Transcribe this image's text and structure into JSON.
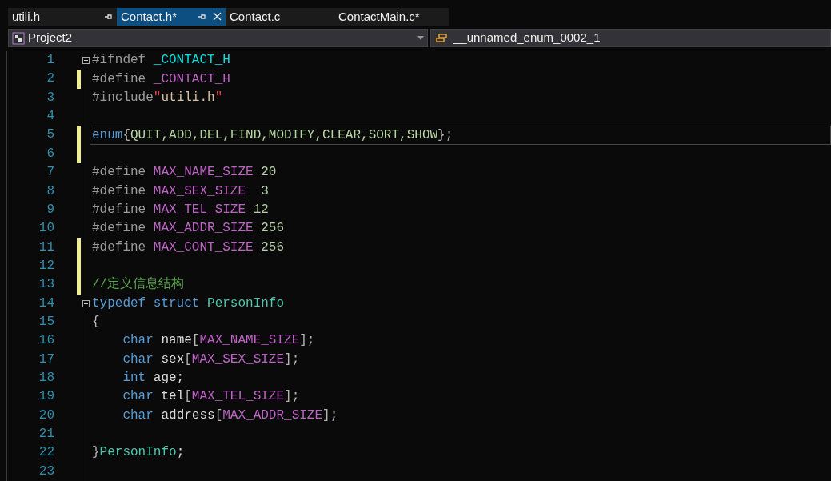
{
  "tabs": [
    {
      "label": "utili.h",
      "selected": false,
      "pinned": true,
      "closable": false
    },
    {
      "label": "Contact.h*",
      "selected": true,
      "pinned": true,
      "closable": true
    },
    {
      "label": "Contact.c",
      "selected": false,
      "pinned": false,
      "closable": false
    },
    {
      "label": "ContactMain.c*",
      "selected": false,
      "pinned": false,
      "closable": false
    }
  ],
  "navigation": {
    "project": "Project2",
    "member": "__unnamed_enum_0002_1"
  },
  "editor": {
    "lines": [
      {
        "number": "1",
        "changed": false,
        "current": false,
        "fold_expanded": true,
        "tokens": [
          {
            "kind": "preproc",
            "text": "#ifndef "
          },
          {
            "kind": "guard",
            "text": "_CONTACT_H"
          }
        ]
      },
      {
        "number": "2",
        "changed": true,
        "current": false,
        "tokens": [
          {
            "kind": "preproc",
            "text": "#define "
          },
          {
            "kind": "macro",
            "text": "_CONTACT_H"
          }
        ]
      },
      {
        "number": "3",
        "changed": false,
        "current": false,
        "tokens": [
          {
            "kind": "preproc",
            "text": "#include"
          },
          {
            "kind": "quote",
            "text": "\""
          },
          {
            "kind": "string",
            "text": "utili.h"
          },
          {
            "kind": "quote",
            "text": "\""
          }
        ]
      },
      {
        "number": "4",
        "changed": false,
        "current": false
      },
      {
        "number": "5",
        "changed": true,
        "current": true,
        "tokens": [
          {
            "kind": "keyword",
            "text": "enum"
          },
          {
            "kind": "punct",
            "text": "{"
          },
          {
            "kind": "enumerator",
            "text": "QUIT,ADD,DEL,FIND,MODIFY,CLEAR,SORT,SHOW"
          },
          {
            "kind": "punct",
            "text": "};"
          }
        ]
      },
      {
        "number": "6",
        "changed": true,
        "current": false
      },
      {
        "number": "7",
        "changed": false,
        "current": false,
        "tokens": [
          {
            "kind": "preproc",
            "text": "#define "
          },
          {
            "kind": "macro",
            "text": "MAX_NAME_SIZE"
          },
          {
            "kind": "number",
            "text": " 20"
          }
        ]
      },
      {
        "number": "8",
        "changed": false,
        "current": false,
        "tokens": [
          {
            "kind": "preproc",
            "text": "#define "
          },
          {
            "kind": "macro",
            "text": "MAX_SEX_SIZE"
          },
          {
            "kind": "number",
            "text": "  3"
          }
        ]
      },
      {
        "number": "9",
        "changed": false,
        "current": false,
        "tokens": [
          {
            "kind": "preproc",
            "text": "#define "
          },
          {
            "kind": "macro",
            "text": "MAX_TEL_SIZE"
          },
          {
            "kind": "number",
            "text": " 12"
          }
        ]
      },
      {
        "number": "10",
        "changed": false,
        "current": false,
        "tokens": [
          {
            "kind": "preproc",
            "text": "#define "
          },
          {
            "kind": "macro",
            "text": "MAX_ADDR_SIZE"
          },
          {
            "kind": "number",
            "text": " 256"
          }
        ]
      },
      {
        "number": "11",
        "changed": true,
        "current": false,
        "tokens": [
          {
            "kind": "preproc",
            "text": "#define "
          },
          {
            "kind": "macro",
            "text": "MAX_CONT_SIZE"
          },
          {
            "kind": "number",
            "text": " 256"
          }
        ]
      },
      {
        "number": "12",
        "changed": true,
        "current": false
      },
      {
        "number": "13",
        "changed": true,
        "current": false,
        "tokens": [
          {
            "kind": "comment",
            "text": "//定义信息结构"
          }
        ]
      },
      {
        "number": "14",
        "changed": false,
        "current": false,
        "fold_expanded": true,
        "tokens": [
          {
            "kind": "keyword",
            "text": "typedef struct "
          },
          {
            "kind": "type",
            "text": "PersonInfo"
          }
        ]
      },
      {
        "number": "15",
        "changed": false,
        "current": false,
        "tokens": [
          {
            "kind": "punct",
            "text": "{"
          }
        ]
      },
      {
        "number": "16",
        "changed": false,
        "current": false,
        "tokens": [
          {
            "kind": "keyword",
            "text": "    char "
          },
          {
            "kind": "plain",
            "text": "name"
          },
          {
            "kind": "punct",
            "text": "["
          },
          {
            "kind": "macro",
            "text": "MAX_NAME_SIZE"
          },
          {
            "kind": "punct",
            "text": "];"
          }
        ]
      },
      {
        "number": "17",
        "changed": false,
        "current": false,
        "tokens": [
          {
            "kind": "keyword",
            "text": "    char "
          },
          {
            "kind": "plain",
            "text": "sex"
          },
          {
            "kind": "punct",
            "text": "["
          },
          {
            "kind": "macro",
            "text": "MAX_SEX_SIZE"
          },
          {
            "kind": "punct",
            "text": "];"
          }
        ]
      },
      {
        "number": "18",
        "changed": false,
        "current": false,
        "tokens": [
          {
            "kind": "keyword",
            "text": "    int "
          },
          {
            "kind": "plain",
            "text": "age;"
          }
        ]
      },
      {
        "number": "19",
        "changed": false,
        "current": false,
        "tokens": [
          {
            "kind": "keyword",
            "text": "    char "
          },
          {
            "kind": "plain",
            "text": "tel"
          },
          {
            "kind": "punct",
            "text": "["
          },
          {
            "kind": "macro",
            "text": "MAX_TEL_SIZE"
          },
          {
            "kind": "punct",
            "text": "];"
          }
        ]
      },
      {
        "number": "20",
        "changed": false,
        "current": false,
        "tokens": [
          {
            "kind": "keyword",
            "text": "    char "
          },
          {
            "kind": "plain",
            "text": "address"
          },
          {
            "kind": "punct",
            "text": "["
          },
          {
            "kind": "macro",
            "text": "MAX_ADDR_SIZE"
          },
          {
            "kind": "punct",
            "text": "];"
          }
        ]
      },
      {
        "number": "21",
        "changed": false,
        "current": false
      },
      {
        "number": "22",
        "changed": false,
        "current": false,
        "tokens": [
          {
            "kind": "punct",
            "text": "}"
          },
          {
            "kind": "type",
            "text": "PersonInfo"
          },
          {
            "kind": "plain",
            "text": ";"
          }
        ]
      },
      {
        "number": "23",
        "changed": false,
        "current": false
      }
    ]
  }
}
